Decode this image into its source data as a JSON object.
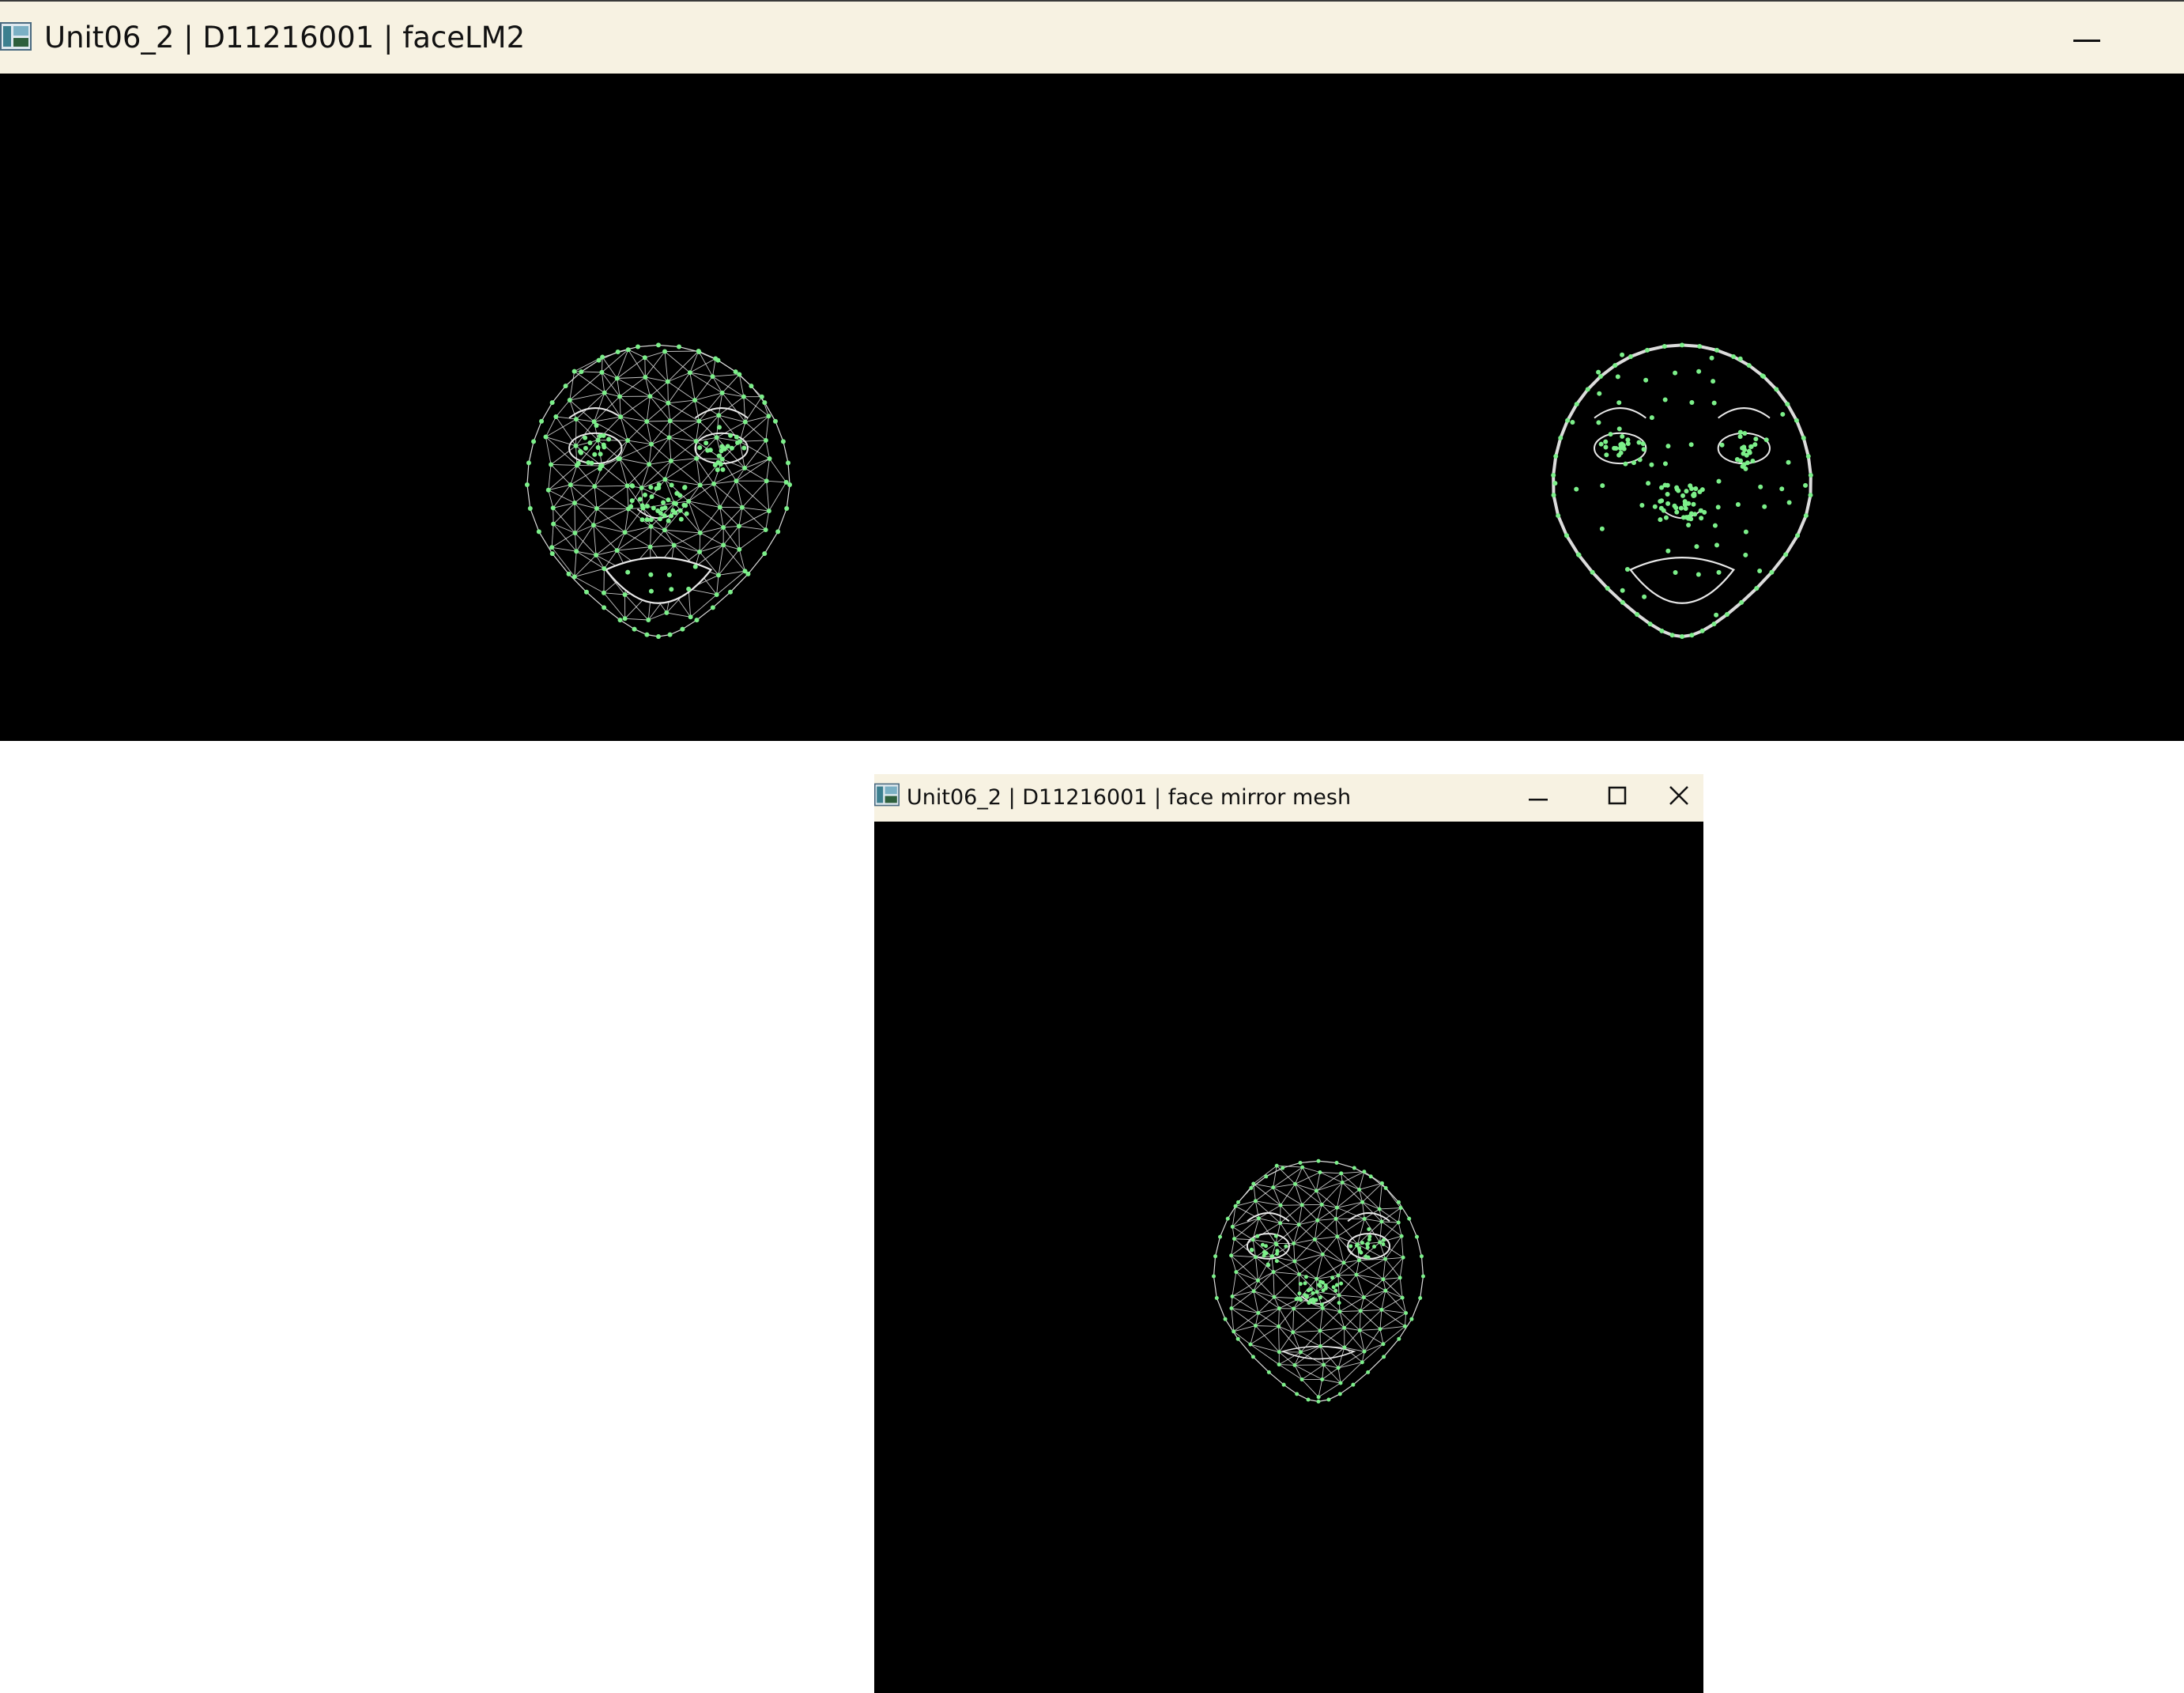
{
  "main_window": {
    "title": "Unit06_2 | D11216001 | faceLM2",
    "icon": "app-window-icon",
    "controls": {
      "minimize": "minimize-icon"
    },
    "views": [
      {
        "name": "face-landmark-mesh-view",
        "mesh": "face-wireframe-mesh",
        "colors": {
          "points": "#7cf08a",
          "lines": "#e8e8e8"
        }
      },
      {
        "name": "face-landmark-contour-view",
        "mesh": "face-contour-mesh",
        "colors": {
          "points": "#7cf08a",
          "lines": "#e8e8e8"
        }
      }
    ]
  },
  "mirror_window": {
    "title": "Unit06_2 | D11216001 | face mirror mesh",
    "icon": "app-window-icon",
    "controls": {
      "minimize": "minimize-icon",
      "maximize": "maximize-icon",
      "close": "close-icon"
    },
    "view": {
      "name": "face-mirror-mesh-view",
      "mesh": "face-wireframe-mesh",
      "colors": {
        "points": "#7cf08a",
        "lines": "#e8e8e8"
      }
    }
  },
  "theme": {
    "titlebar_bg": "#f7f2e2",
    "canvas_bg": "#000000",
    "desktop_bg": "#ffffff"
  }
}
